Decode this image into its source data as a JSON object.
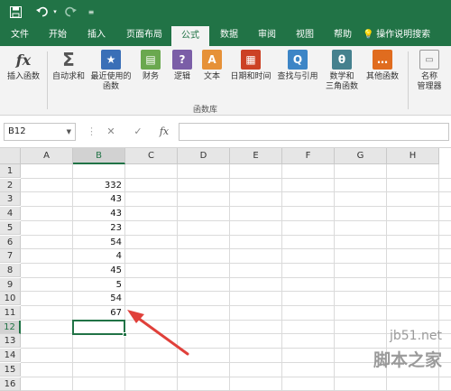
{
  "quick_access": {
    "save_icon": "save-icon",
    "undo_icon": "undo-icon",
    "redo_icon": "redo-icon",
    "customize_icon": "customize-icon"
  },
  "tabs": [
    {
      "label": "文件",
      "active": false
    },
    {
      "label": "开始",
      "active": false
    },
    {
      "label": "插入",
      "active": false
    },
    {
      "label": "页面布局",
      "active": false
    },
    {
      "label": "公式",
      "active": true
    },
    {
      "label": "数据",
      "active": false
    },
    {
      "label": "审阅",
      "active": false
    },
    {
      "label": "视图",
      "active": false
    },
    {
      "label": "帮助",
      "active": false
    }
  ],
  "tell_me": {
    "icon": "lightbulb-icon",
    "label": "操作说明搜索"
  },
  "ribbon": {
    "buttons": [
      {
        "line1": "插入函数",
        "line2": "",
        "icon": "fx-icon",
        "color": "#6b6b6b"
      },
      {
        "line1": "自动求和",
        "line2": "",
        "icon": "sigma-icon",
        "color": "#555555"
      },
      {
        "line1": "最近使用的",
        "line2": "函数",
        "icon": "star-book-icon",
        "color": "#3a6fb7"
      },
      {
        "line1": "财务",
        "line2": "",
        "icon": "finance-book-icon",
        "color": "#6aa84f"
      },
      {
        "line1": "逻辑",
        "line2": "",
        "icon": "logic-book-icon",
        "color": "#7b5ea7"
      },
      {
        "line1": "文本",
        "line2": "",
        "icon": "text-book-icon",
        "color": "#e69138"
      },
      {
        "line1": "日期和时间",
        "line2": "",
        "icon": "date-book-icon",
        "color": "#cc4125"
      },
      {
        "line1": "查找与引用",
        "line2": "",
        "icon": "lookup-book-icon",
        "color": "#3d85c6"
      },
      {
        "line1": "数学和",
        "line2": "三角函数",
        "icon": "math-book-icon",
        "color": "#45818e"
      },
      {
        "line1": "其他函数",
        "line2": "",
        "icon": "more-book-icon",
        "color": "#e06c1f"
      },
      {
        "line1": "名称",
        "line2": "管理器",
        "icon": "name-manager-icon",
        "color": "#888888"
      }
    ],
    "icon_glyphs": [
      "fx",
      "Σ",
      "★",
      "▤",
      "?",
      "A",
      "▦",
      "Q",
      "θ",
      "…",
      "▭"
    ],
    "group_label": "函数库"
  },
  "formula_bar": {
    "name_box": "B12",
    "cancel": "✕",
    "enter": "✓",
    "fx": "fx",
    "content": ""
  },
  "grid": {
    "columns": [
      "A",
      "B",
      "C",
      "D",
      "E",
      "F",
      "G",
      "H"
    ],
    "selected_column": "B",
    "rows": [
      "1",
      "2",
      "3",
      "4",
      "5",
      "6",
      "7",
      "8",
      "9",
      "10",
      "11",
      "12",
      "13",
      "14",
      "15",
      "16"
    ],
    "selected_row": "12",
    "column_b_values": [
      "",
      "332",
      "43",
      "43",
      "23",
      "54",
      "4",
      "45",
      "5",
      "54",
      "67",
      "",
      "",
      "",
      "",
      ""
    ],
    "annotation": "red-arrow-pointing-to-B11",
    "arrow_color": "#e0403a",
    "accent_color": "#217346"
  },
  "watermark": {
    "line1": "jb51.net",
    "line2": "脚本之家"
  }
}
